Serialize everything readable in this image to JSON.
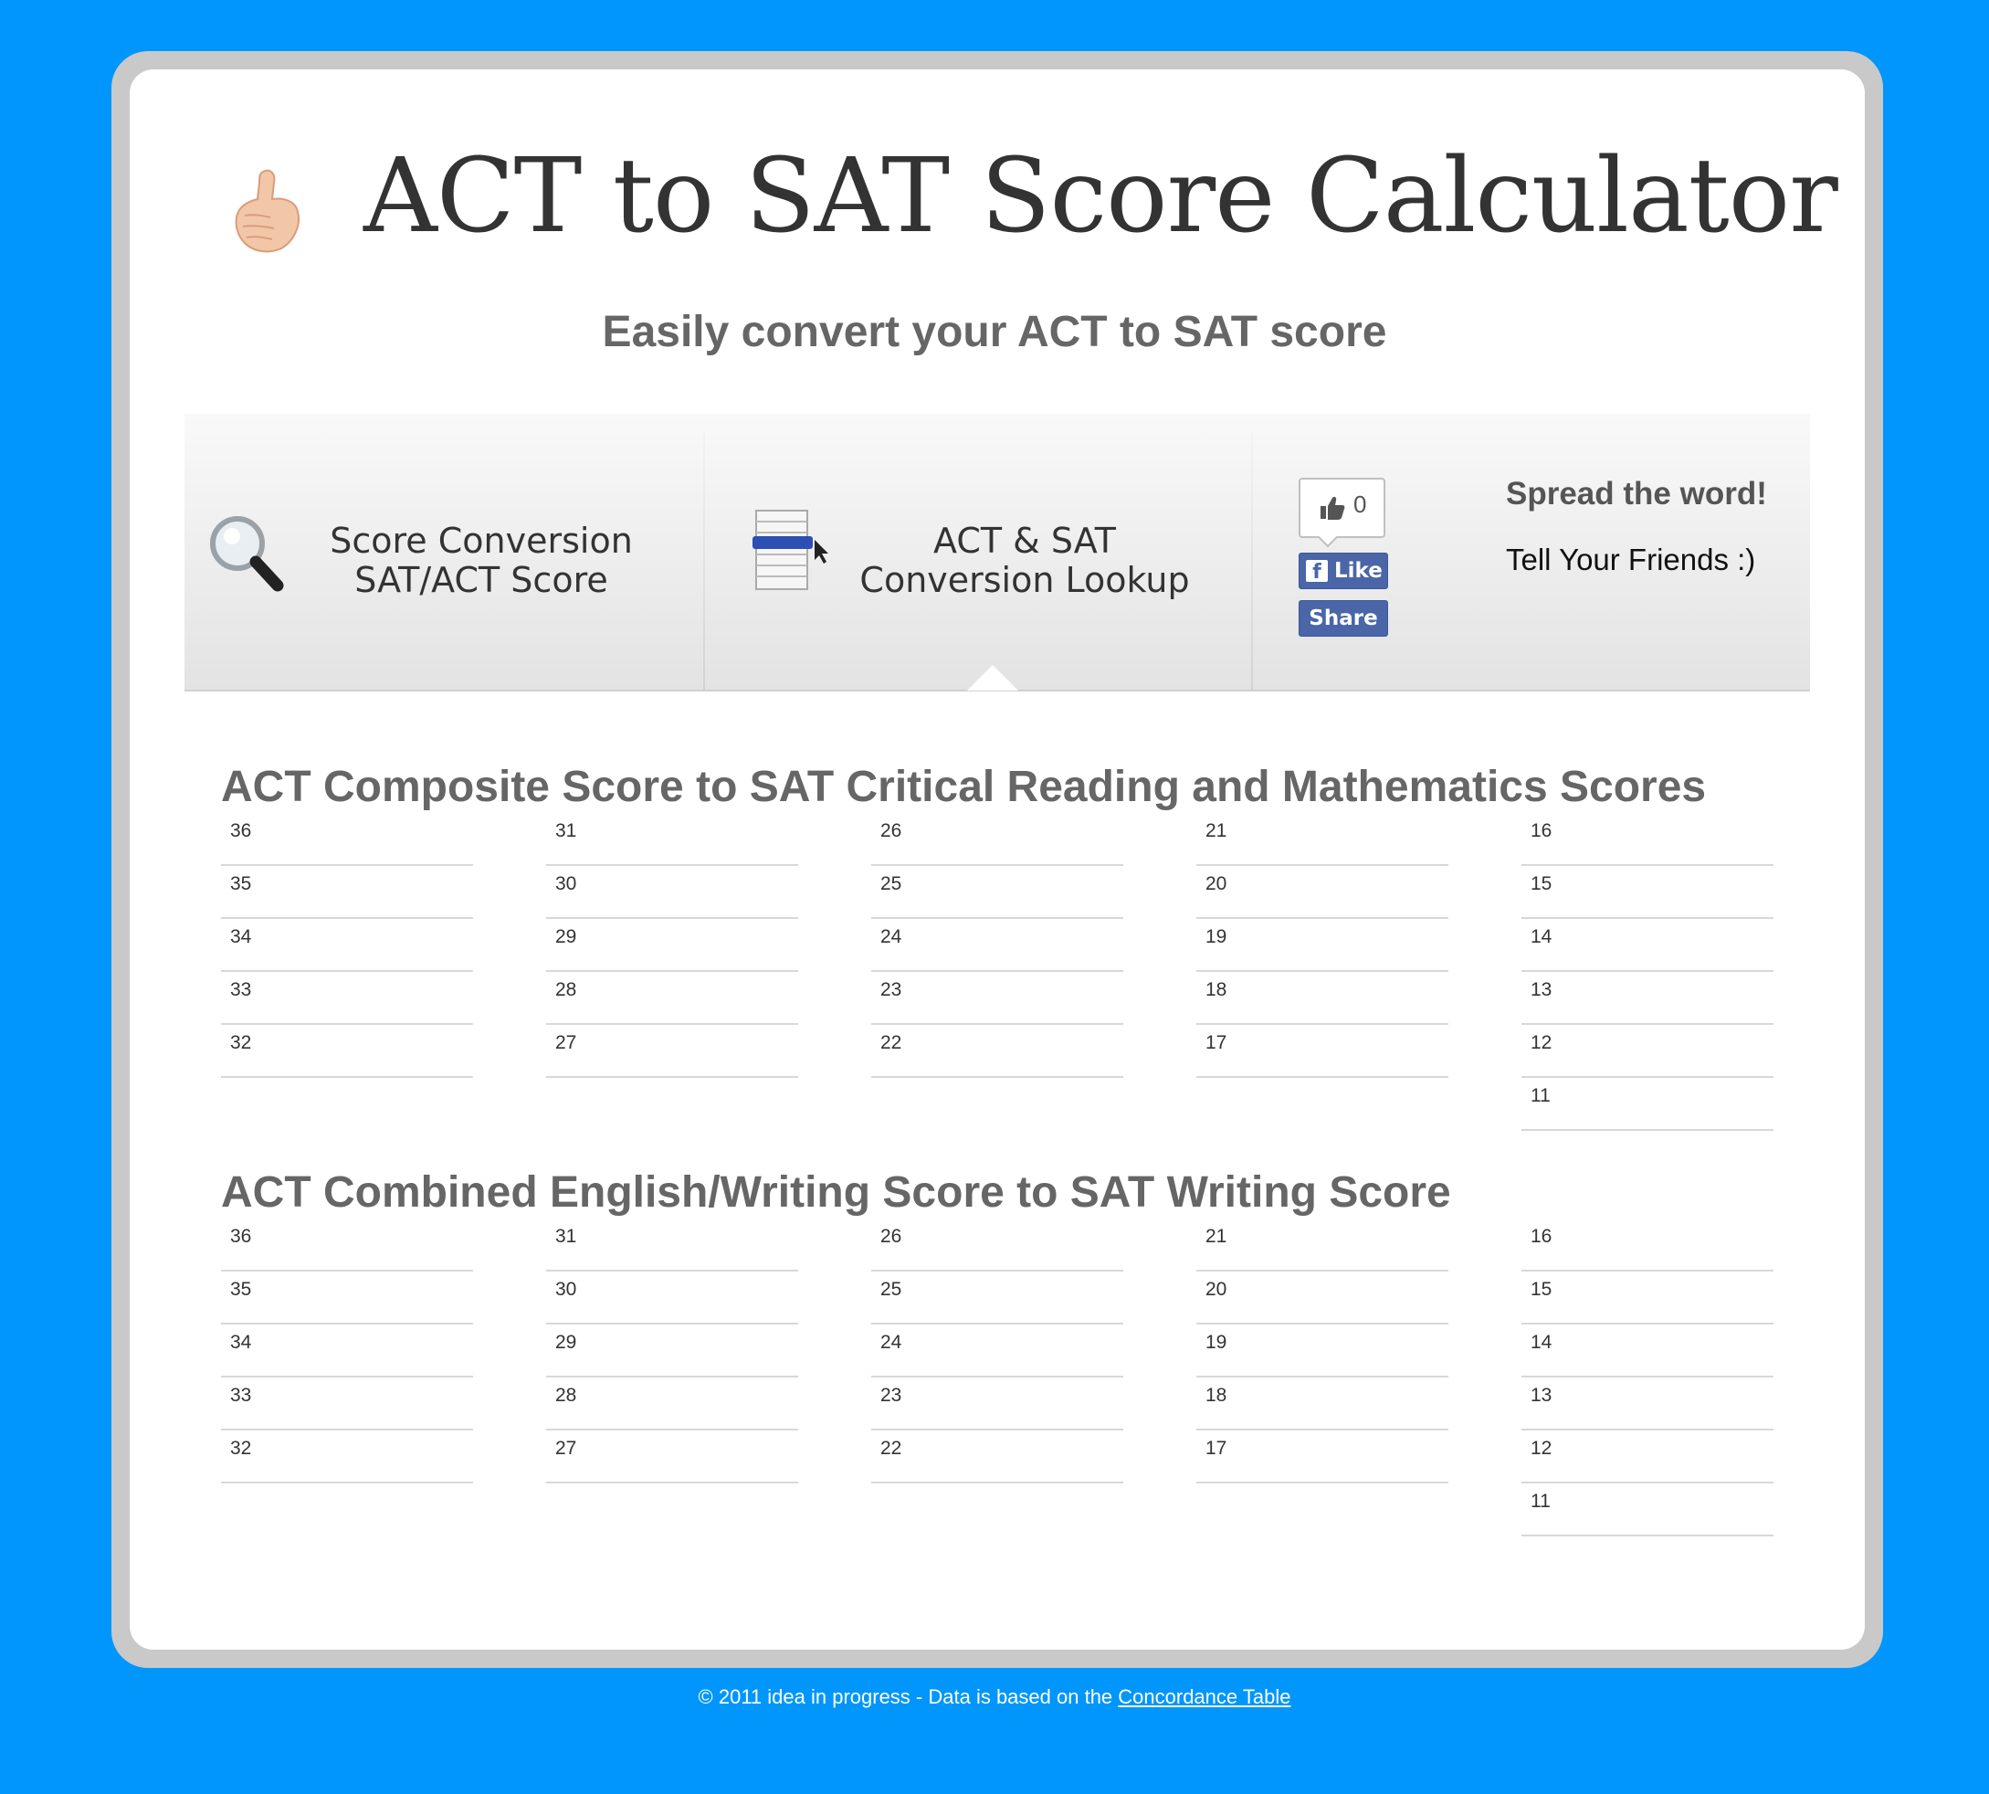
{
  "header": {
    "icon": "thumbs-up-icon",
    "title": "ACT to SAT Score Calculator",
    "subtitle": "Easily convert your ACT to SAT score"
  },
  "nav": {
    "items": [
      {
        "icon": "magnifier-icon",
        "line1": "Score Conversion",
        "line2": "SAT/ACT Score"
      },
      {
        "icon": "table-lookup-icon",
        "line1": "ACT & SAT",
        "line2": "Conversion Lookup",
        "active": true
      }
    ],
    "facebook": {
      "count": "0",
      "like_label": "Like",
      "share_label": "Share"
    },
    "spread": {
      "title": "Spread the word!",
      "text": "Tell Your Friends :)"
    }
  },
  "sections": [
    {
      "title": "ACT Composite Score to SAT Critical Reading and Mathematics Scores",
      "columns": [
        [
          "36",
          "35",
          "34",
          "33",
          "32"
        ],
        [
          "31",
          "30",
          "29",
          "28",
          "27"
        ],
        [
          "26",
          "25",
          "24",
          "23",
          "22"
        ],
        [
          "21",
          "20",
          "19",
          "18",
          "17"
        ],
        [
          "16",
          "15",
          "14",
          "13",
          "12",
          "11"
        ]
      ]
    },
    {
      "title": "ACT Combined English/Writing Score to SAT Writing Score",
      "columns": [
        [
          "36",
          "35",
          "34",
          "33",
          "32"
        ],
        [
          "31",
          "30",
          "29",
          "28",
          "27"
        ],
        [
          "26",
          "25",
          "24",
          "23",
          "22"
        ],
        [
          "21",
          "20",
          "19",
          "18",
          "17"
        ],
        [
          "16",
          "15",
          "14",
          "13",
          "12",
          "11"
        ]
      ]
    }
  ],
  "footer": {
    "text": "© 2011 idea in progress - Data is based on the ",
    "link_label": "Concordance Table"
  },
  "colors": {
    "background": "#0096fb",
    "facebook": "#4a66a8",
    "heading": "#666666"
  }
}
